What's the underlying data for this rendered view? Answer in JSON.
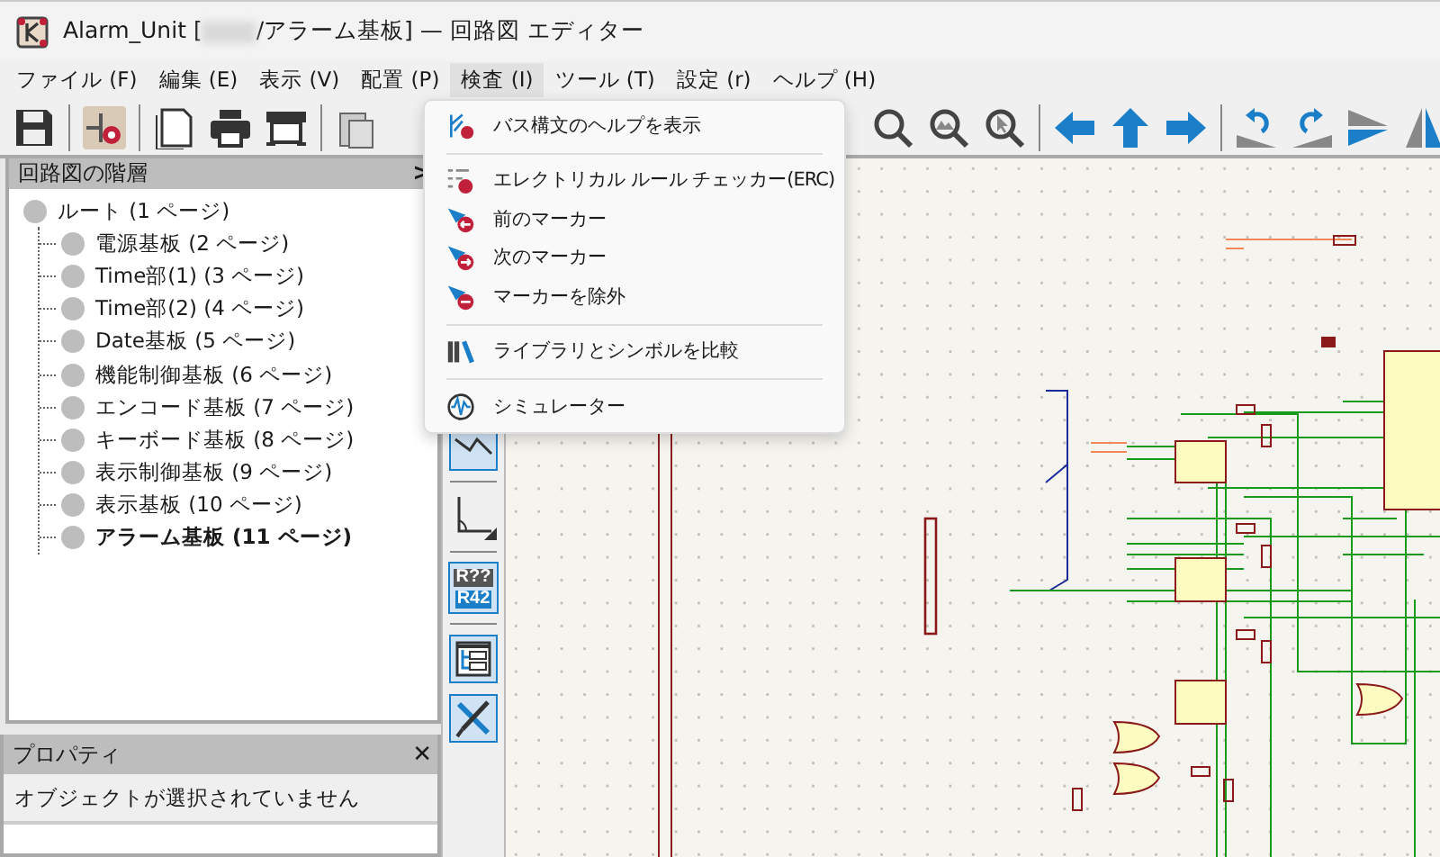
{
  "window": {
    "title_start": "Alarm_Unit [",
    "title_end": "/アラーム基板] — 回路図 エディター"
  },
  "menu_bar": [
    {
      "label": "ファイル (F)",
      "selected": false
    },
    {
      "label": "編集 (E)",
      "selected": false
    },
    {
      "label": "表示 (V)",
      "selected": false
    },
    {
      "label": "配置 (P)",
      "selected": false
    },
    {
      "label": "検査 (I)",
      "selected": true
    },
    {
      "label": "ツール (T)",
      "selected": false
    },
    {
      "label": "設定 (r)",
      "selected": false
    },
    {
      "label": "ヘルプ (H)",
      "selected": false
    }
  ],
  "dropdown_menu": {
    "groups": [
      [
        "バス構文のヘルプを表示"
      ],
      [
        "エレクトリカル ルール チェッカー(ERC)",
        "前のマーカー",
        "次のマーカー",
        "マーカーを除外"
      ],
      [
        "ライブラリとシンボルを比較"
      ],
      [
        "シミュレーター"
      ]
    ]
  },
  "hierarchy_panel": {
    "title": "回路図の階層",
    "collapse": ">",
    "root": {
      "label": "ルート (1 ページ)",
      "children": [
        {
          "label": "電源基板 (2 ページ)",
          "selected": false
        },
        {
          "label": "Time部(1) (3 ページ)",
          "selected": false
        },
        {
          "label": "Time部(2) (4 ページ)",
          "selected": false
        },
        {
          "label": "Date基板 (5 ページ)",
          "selected": false
        },
        {
          "label": "機能制御基板 (6 ページ)",
          "selected": false
        },
        {
          "label": "エンコード基板 (7 ページ)",
          "selected": false
        },
        {
          "label": "キーボード基板 (8 ページ)",
          "selected": false
        },
        {
          "label": "表示制御基板 (9 ページ)",
          "selected": false
        },
        {
          "label": "表示基板 (10 ページ)",
          "selected": false
        },
        {
          "label": "アラーム基板 (11 ページ)",
          "selected": true
        }
      ]
    }
  },
  "annotate_button": {
    "top": "R??",
    "bottom": "R42"
  },
  "properties_panel": {
    "title": "プロパティ",
    "close": "✕",
    "message": "オブジェクトが選択されていません"
  }
}
